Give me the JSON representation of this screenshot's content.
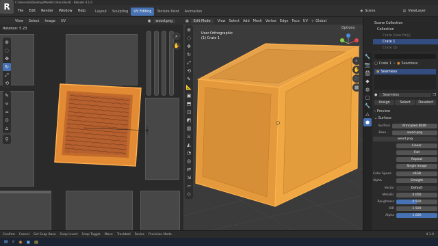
{
  "window": {
    "title": "C:\\Users\\eh\\Desktop\\Model\\crates.blend] - Blender 4.1.0"
  },
  "menu": {
    "items": [
      "File",
      "Edit",
      "Render",
      "Window",
      "Help"
    ]
  },
  "workspaces": [
    "Layout",
    "Sculpting",
    "UV Editing",
    "Texture Paint",
    "Animation"
  ],
  "active_workspace": "UV Editing",
  "scene": {
    "label": "Scene",
    "view_layer": "ViewLayer"
  },
  "uv_editor": {
    "header": [
      "View",
      "Select",
      "Image",
      "UV"
    ],
    "image_name": "wood.png",
    "rotation_text": "Rotation: 5.23"
  },
  "viewport": {
    "mode": "Edit Mode",
    "header": [
      "View",
      "Select",
      "Add",
      "Mesh",
      "Vertex",
      "Edge",
      "Face",
      "UV"
    ],
    "orientation": "Global",
    "view_label": "User Orthographic",
    "object_label": "(1) Crate 1",
    "options": "Options"
  },
  "outliner": {
    "title": "Scene Collection",
    "items": [
      "Collection",
      "Crate (Low Poly)",
      "Crate 1",
      "Crate 1b"
    ]
  },
  "properties": {
    "search_placeholder": "",
    "object": "Crate 1",
    "material_breadcrumb": "Seamless",
    "material_slot": "Seamless",
    "material_name": "Seamless",
    "buttons": [
      "Assign",
      "Select",
      "Deselect"
    ],
    "panels": {
      "preview": "Preview",
      "surface": "Surface"
    },
    "surface": {
      "label": "Surface",
      "value": "Principled BSDF"
    },
    "base_color": {
      "label": "Base ...",
      "value": "wood.png"
    },
    "image": "wood.png",
    "interp": "Linear",
    "proj": "Flat",
    "ext": "Repeat",
    "source": "Single Image",
    "color_space": {
      "label": "Color Space",
      "value": "sRGB"
    },
    "alpha": {
      "label": "Alpha",
      "value": "Straight"
    },
    "vector": {
      "label": "Vector",
      "value": "Default"
    },
    "metallic": {
      "label": "Metallic",
      "value": "0.000"
    },
    "roughness": {
      "label": "Roughness",
      "value": "0.500"
    },
    "ior": {
      "label": "IOR",
      "value": "1.500"
    },
    "alpha_val": {
      "label": "Alpha",
      "value": "1.000"
    }
  },
  "status": {
    "items": [
      "Confirm",
      "Cancel",
      "Set Snap Base",
      "Snap Invert",
      "Snap Toggle",
      "Move",
      "Trackball",
      "Resize",
      "Precision Mode"
    ],
    "version": "4.1.0"
  },
  "colors": {
    "accent": "#4772b3",
    "selection": "#f5a63a",
    "wood": "#b5602e"
  }
}
